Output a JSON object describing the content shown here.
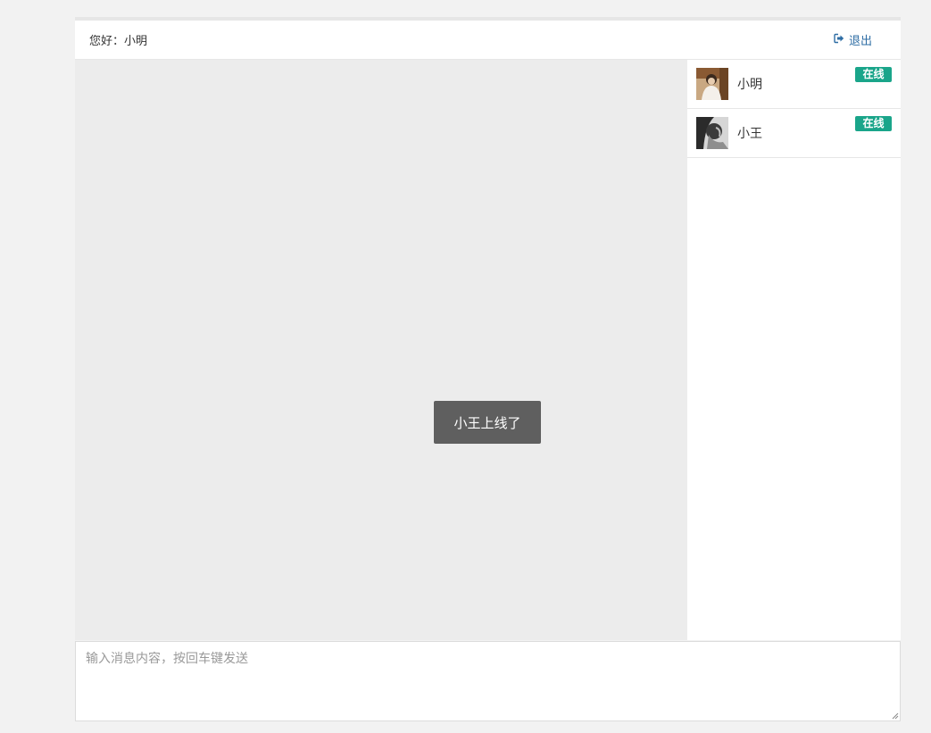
{
  "header": {
    "greeting_prefix": "您好：",
    "username": "小明",
    "logout_label": "退出",
    "logout_icon": "sign-out-icon"
  },
  "chat": {
    "toast": "小王上线了"
  },
  "users": [
    {
      "name": "小明",
      "status": "在线",
      "avatar": "avatar-xiaoming"
    },
    {
      "name": "小王",
      "status": "在线",
      "avatar": "avatar-xiaowang"
    }
  ],
  "composer": {
    "placeholder": "输入消息内容，按回车键发送"
  },
  "colors": {
    "page_bg": "#f2f2f2",
    "chat_bg": "#ececec",
    "online_badge": "#1aa58a",
    "link": "#2e6da4",
    "toast_bg": "#5f5f5f"
  }
}
